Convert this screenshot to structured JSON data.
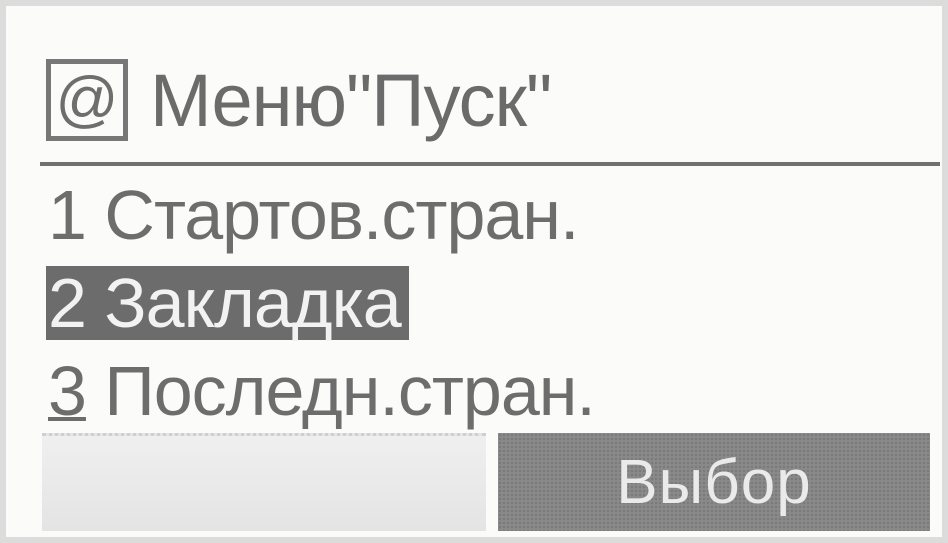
{
  "header": {
    "icon_glyph": "@",
    "title": "Меню\"Пуск\""
  },
  "menu": {
    "items": [
      {
        "number": "1",
        "label": "Стартов.стран.",
        "selected": false
      },
      {
        "number": "2",
        "label": "Закладка",
        "selected": true
      },
      {
        "number": "3",
        "label": "Последн.стран.",
        "selected": false
      }
    ]
  },
  "softkeys": {
    "left_label": "",
    "right_label": "Выбор"
  },
  "colors": {
    "text": "#6b6b6b",
    "selection_bg": "#6c6c6c",
    "selection_text": "#f2f2f2",
    "softkey_active_bg": "#8a8a8a"
  }
}
